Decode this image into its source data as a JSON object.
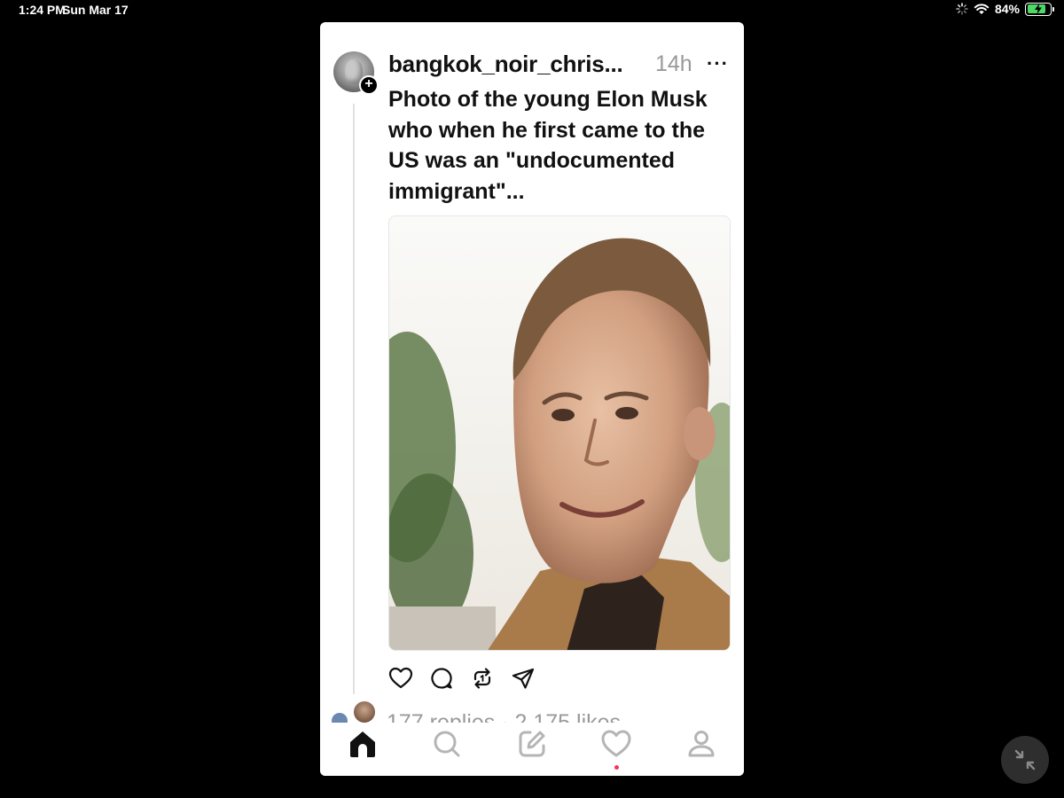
{
  "status_bar": {
    "time": "1:24 PM",
    "date": "Sun Mar 17",
    "battery_percent": "84%",
    "battery_level": 0.84,
    "icons": [
      "activity-spinner-icon",
      "wifi-icon",
      "battery-charging-icon"
    ]
  },
  "post": {
    "username": "bangkok_noir_chris...",
    "time_ago": "14h",
    "more_label": "···",
    "follow_badge": "+",
    "text": "Photo of the young Elon Musk who when he first came to the US was an \"undocumented immigrant\"...",
    "stats": "177 replies · 2,175 likes",
    "actions": [
      "like-icon",
      "reply-icon",
      "repost-icon",
      "share-icon"
    ]
  },
  "tab_bar": {
    "tabs": [
      "home-icon",
      "search-icon",
      "compose-icon",
      "activity-heart-icon",
      "profile-icon"
    ],
    "active": "home-icon",
    "notification_dot_color": "#ff3050"
  },
  "colors": {
    "background": "#000000",
    "card": "#ffffff",
    "muted_text": "#999999",
    "battery_green": "#4cd964"
  }
}
